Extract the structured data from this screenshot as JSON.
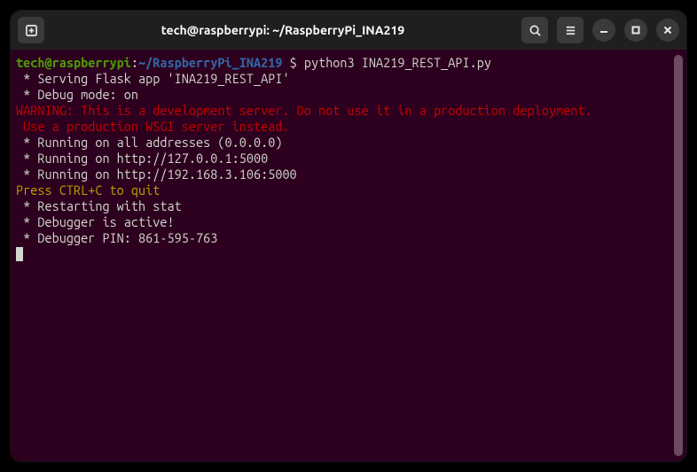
{
  "titlebar": {
    "title": "tech@raspberrypi: ~/RaspberryPi_INA219"
  },
  "prompt": {
    "user_host": "tech@raspberrypi",
    "sep1": ":",
    "path": "~/RaspberryPi_INA219",
    "sep2": " $ ",
    "command": "python3 INA219_REST_API.py"
  },
  "output": {
    "l1": " * Serving Flask app 'INA219_REST_API'",
    "l2": " * Debug mode: on",
    "warn1": "WARNING: This is a development server. Do not use it in a production deployment.",
    "warn2": " Use a production WSGI server instead.",
    "l3": " * Running on all addresses (0.0.0.0)",
    "l4": " * Running on http://127.0.0.1:5000",
    "l5": " * Running on http://192.168.3.106:5000",
    "quit": "Press CTRL+C to quit",
    "l6": " * Restarting with stat",
    "l7": " * Debugger is active!",
    "l8": " * Debugger PIN: 861-595-763"
  }
}
